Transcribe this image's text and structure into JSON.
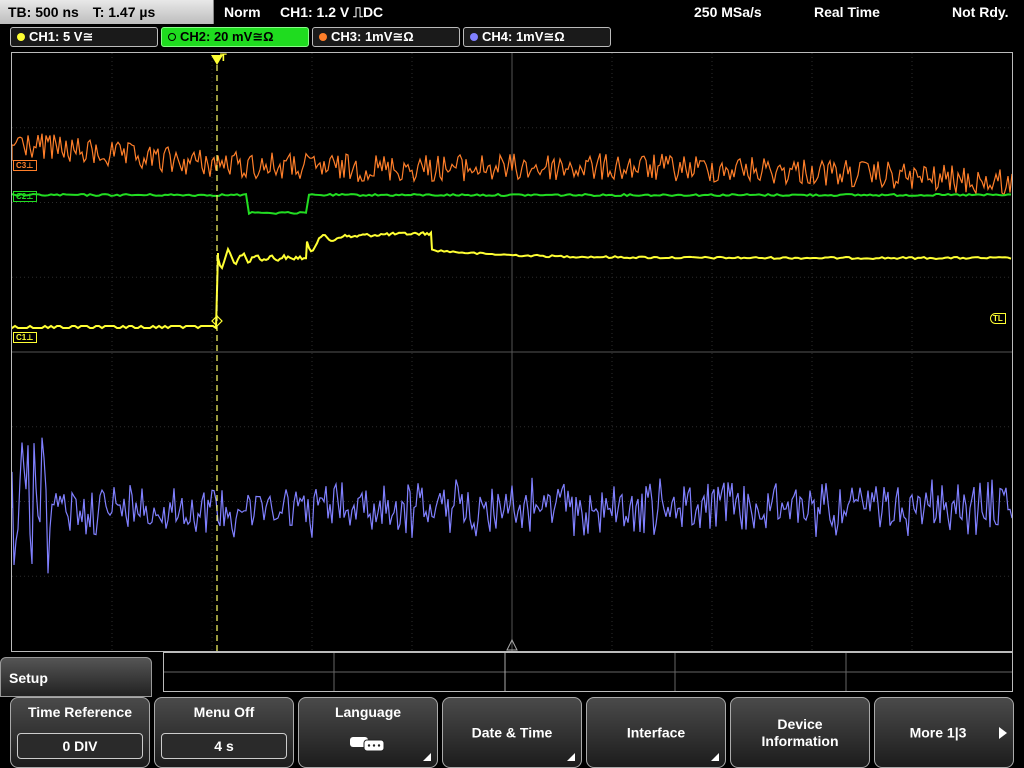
{
  "topbar": {
    "tb": "TB: 500 ns",
    "trig_time": "T: 1.47 µs",
    "mode": "Norm",
    "trigger": "CH1: 1.2 V ⎍DC",
    "sample_rate": "250 MSa/s",
    "acq_mode": "Real Time",
    "status": "Not Rdy."
  },
  "channels": [
    {
      "label": "CH1: 5 V≅",
      "color": "#ffff33"
    },
    {
      "label": "CH2: 20 mV≅Ω",
      "color": "#22dd22"
    },
    {
      "label": "CH3: 1mV≅Ω",
      "color": "#ff7f2a"
    },
    {
      "label": "CH4: 1mV≅Ω",
      "color": "#8080ff"
    }
  ],
  "markers": {
    "c1": "C1⊥",
    "c2": "C2⊥",
    "c3": "C3⊥",
    "tl": "TL",
    "trigger_pos": "T"
  },
  "menu": {
    "title": "Setup",
    "time_reference": {
      "label": "Time Reference",
      "value": "0 DIV"
    },
    "menu_off": {
      "label": "Menu Off",
      "value": "4 s"
    },
    "language": {
      "label": "Language",
      "icon": "speech-bubbles-icon"
    },
    "date_time": {
      "label": "Date & Time"
    },
    "interface": {
      "label": "Interface"
    },
    "device_info": {
      "label_line1": "Device",
      "label_line2": "Information"
    },
    "more": {
      "label": "More 1|3"
    }
  }
}
